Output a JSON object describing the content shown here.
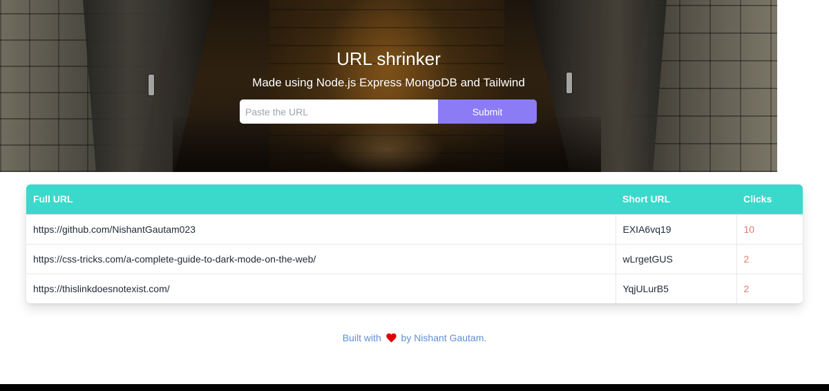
{
  "hero": {
    "title": "URL shrinker",
    "subtitle": "Made using Node.js Express MongoDB and Tailwind",
    "input_placeholder": "Paste the URL",
    "submit_label": "Submit"
  },
  "table": {
    "headers": {
      "full_url": "Full URL",
      "short_url": "Short URL",
      "clicks": "Clicks"
    },
    "rows": [
      {
        "full_url": "https://github.com/NishantGautam023",
        "short_url": "EXIA6vq19",
        "clicks": "10"
      },
      {
        "full_url": "https://css-tricks.com/a-complete-guide-to-dark-mode-on-the-web/",
        "short_url": "wLrgetGUS",
        "clicks": "2"
      },
      {
        "full_url": "https://thislinkdoesnotexist.com/",
        "short_url": "YqjULurB5",
        "clicks": "2"
      }
    ]
  },
  "footer": {
    "before": "Built with",
    "heart_icon": "heart-icon",
    "after": "by Nishant Gautam."
  },
  "colors": {
    "accent": "#8b7cf6",
    "table_header": "#3bd9cc",
    "clicks_text": "#e07b73",
    "footer_text": "#5b8fd8",
    "heart": "#e00000"
  }
}
